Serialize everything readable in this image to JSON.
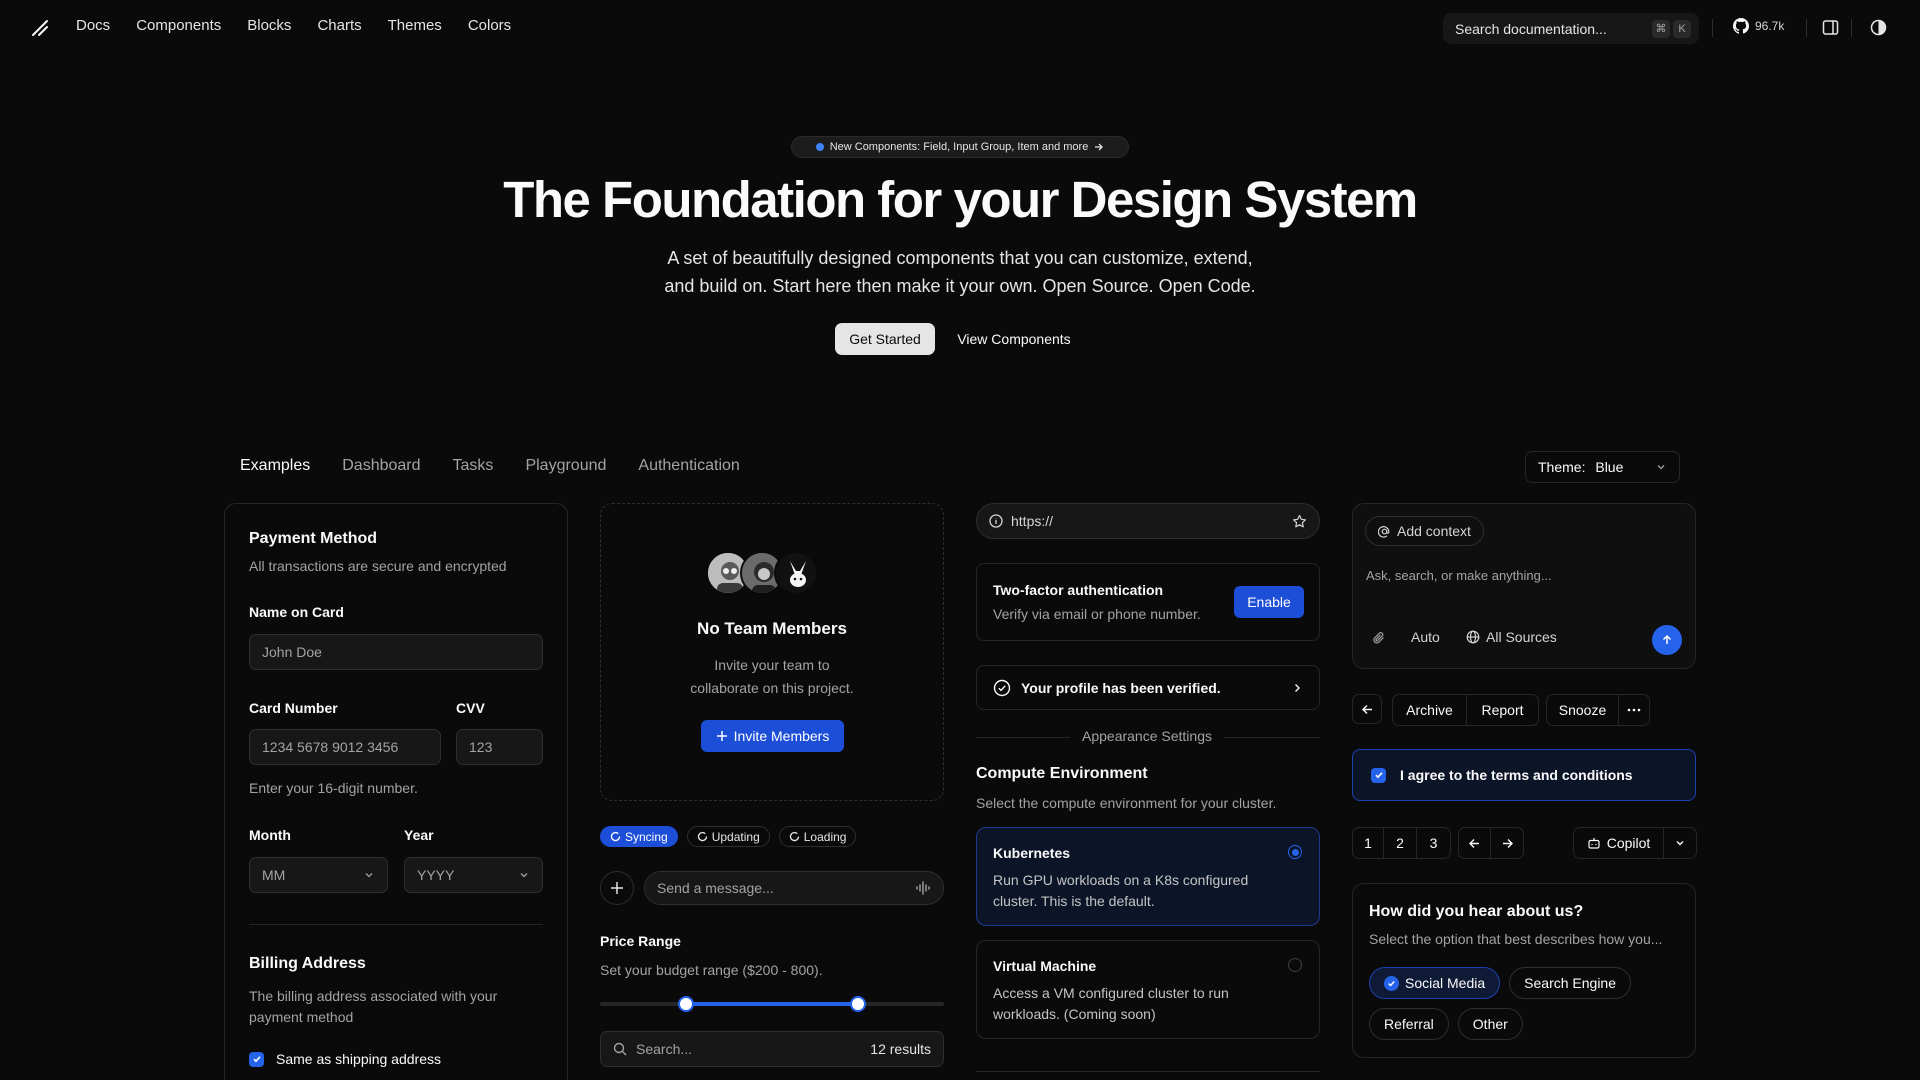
{
  "header": {
    "nav": [
      "Docs",
      "Components",
      "Blocks",
      "Charts",
      "Themes",
      "Colors"
    ],
    "search_placeholder": "Search documentation...",
    "kbd_cmd": "⌘",
    "kbd_k": "K",
    "github_stars": "96.7k"
  },
  "hero": {
    "badge": "New Components: Field, Input Group, Item and more",
    "title": "The Foundation for your Design System",
    "subtitle_line1": "A set of beautifully designed components that you can customize, extend,",
    "subtitle_line2": "and build on. Start here then make it your own. Open Source. Open Code.",
    "primary_cta": "Get Started",
    "secondary_cta": "View Components"
  },
  "tabs": [
    "Examples",
    "Dashboard",
    "Tasks",
    "Playground",
    "Authentication"
  ],
  "theme_select": {
    "label": "Theme:",
    "value": "Blue"
  },
  "payment": {
    "title": "Payment Method",
    "description": "All transactions are secure and encrypted",
    "name_label": "Name on Card",
    "name_placeholder": "John Doe",
    "card_label": "Card Number",
    "card_placeholder": "1234 5678 9012 3456",
    "cvv_label": "CVV",
    "cvv_placeholder": "123",
    "card_hint": "Enter your 16-digit number.",
    "month_label": "Month",
    "month_value": "MM",
    "year_label": "Year",
    "year_value": "YYYY",
    "billing_title": "Billing Address",
    "billing_desc_line1": "The billing address associated with your",
    "billing_desc_line2": "payment method",
    "same_address_label": "Same as shipping address"
  },
  "team": {
    "title": "No Team Members",
    "desc_line1": "Invite your team to",
    "desc_line2": "collaborate on this project.",
    "button": "Invite Members"
  },
  "status_pills": [
    "Syncing",
    "Updating",
    "Loading"
  ],
  "message_placeholder": "Send a message...",
  "price": {
    "title": "Price Range",
    "desc": "Set your budget range ($200 - 800).",
    "low_fraction": 0.25,
    "high_fraction": 0.75
  },
  "search_results": {
    "placeholder": "Search...",
    "count": "12 results"
  },
  "url_input": {
    "value": "https://"
  },
  "two_factor": {
    "title": "Two-factor authentication",
    "desc": "Verify via email or phone number.",
    "button": "Enable"
  },
  "verified": "Your profile has been verified.",
  "appearance_divider": "Appearance Settings",
  "compute": {
    "title": "Compute Environment",
    "desc": "Select the compute environment for your cluster.",
    "options": [
      {
        "name": "Kubernetes",
        "line1": "Run GPU workloads on a K8s configured",
        "line2": "cluster. This is the default."
      },
      {
        "name": "Virtual Machine",
        "line1": "Access a VM configured cluster to run",
        "line2": "workloads. (Coming soon)"
      }
    ]
  },
  "prompt": {
    "context_button": "Add context",
    "placeholder": "Ask, search, or make anything...",
    "mode": "Auto",
    "sources": "All Sources"
  },
  "actions": [
    "Archive",
    "Report",
    "Snooze"
  ],
  "terms": "I agree to the terms and conditions",
  "pagination": [
    "1",
    "2",
    "3"
  ],
  "copilot": "Copilot",
  "survey": {
    "title": "How did you hear about us?",
    "desc": "Select the option that best describes how you...",
    "options": [
      "Social Media",
      "Search Engine",
      "Referral",
      "Other"
    ]
  },
  "colors": {
    "accent": "#2563eb",
    "background": "#0a0a0a",
    "border": "#262626"
  }
}
